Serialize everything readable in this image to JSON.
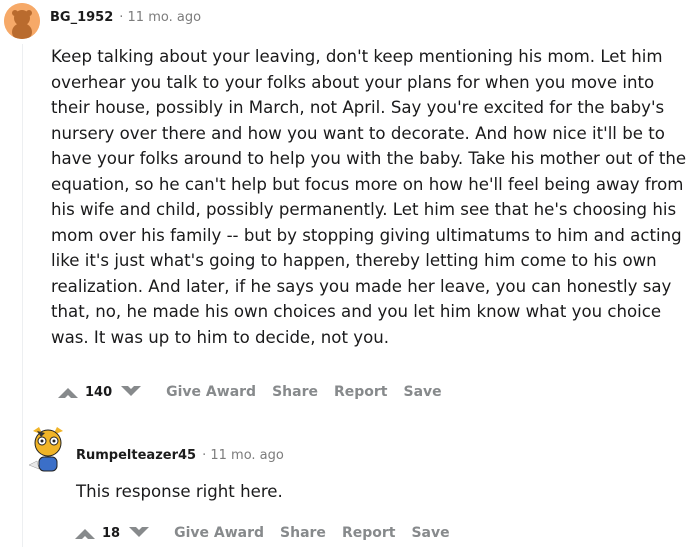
{
  "comment": {
    "author": "BG_1952",
    "meta": "· 11 mo. ago",
    "body": "Keep talking about your leaving, don't keep mentioning his mom. Let him overhear you talk to your folks about your plans for when you move into their house, possibly in March, not April. Say you're excited for the baby's nursery over there and how you want to decorate. And how nice it'll be to have your folks around to help you with the baby. Take his mother out of the equation, so he can't help but focus more on how he'll feel being away from his wife and child, possibly permanently. Let him see that he's choosing his mom over his family -- but by stopping giving ultimatums to him and acting like it's just what's going to happen, thereby letting him come to his own realization. And later, if he says you made her leave, you can honestly say that, no, he made his own choices and you let him know what you choice was. It was up to him to decide, not you.",
    "votes": "140",
    "actions": {
      "award": "Give Award",
      "share": "Share",
      "report": "Report",
      "save": "Save"
    }
  },
  "reply": {
    "author": "Rumpelteazer45",
    "meta": "· 11 mo. ago",
    "body": "This response right here.",
    "votes": "18",
    "actions": {
      "award": "Give Award",
      "share": "Share",
      "report": "Report",
      "save": "Save"
    }
  },
  "colors": {
    "avatar_orange": "#f6a968",
    "meta_gray": "#7c7c7c",
    "action_gray": "#878a8c"
  }
}
